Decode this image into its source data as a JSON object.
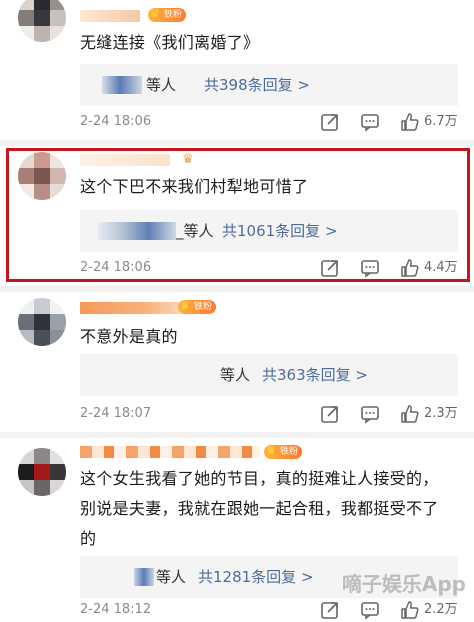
{
  "colors": {
    "accent": "#4d6c9c",
    "highlight": "#c4161c",
    "badge": "#ff7a2e"
  },
  "badge_label": "铁粉",
  "comments": [
    {
      "text": "无缝连接《我们离婚了》",
      "reply_who": "等人",
      "reply_count": "共398条回复 >",
      "time": "2-24 18:06",
      "likes": "6.7万"
    },
    {
      "text": "这个下巴不来我们村犁地可惜了",
      "reply_who": "_等人",
      "reply_count": "共1061条回复 >",
      "time": "2-24 18:06",
      "likes": "4.4万"
    },
    {
      "text": "不意外是真的",
      "reply_who": "等人",
      "reply_count": "共363条回复 >",
      "time": "2-24 18:07",
      "likes": "2.3万"
    },
    {
      "text_lines": [
        "这个女生我看了她的节目，真的挺难让人接受的，",
        "别说是夫妻，我就在跟她一起合租，我都挺受不了",
        "的"
      ],
      "reply_who": "等人",
      "reply_count": "共1281条回复 >",
      "time": "2-24 18:12",
      "likes": "2.2万"
    }
  ],
  "watermark": "嘀子娱乐App"
}
